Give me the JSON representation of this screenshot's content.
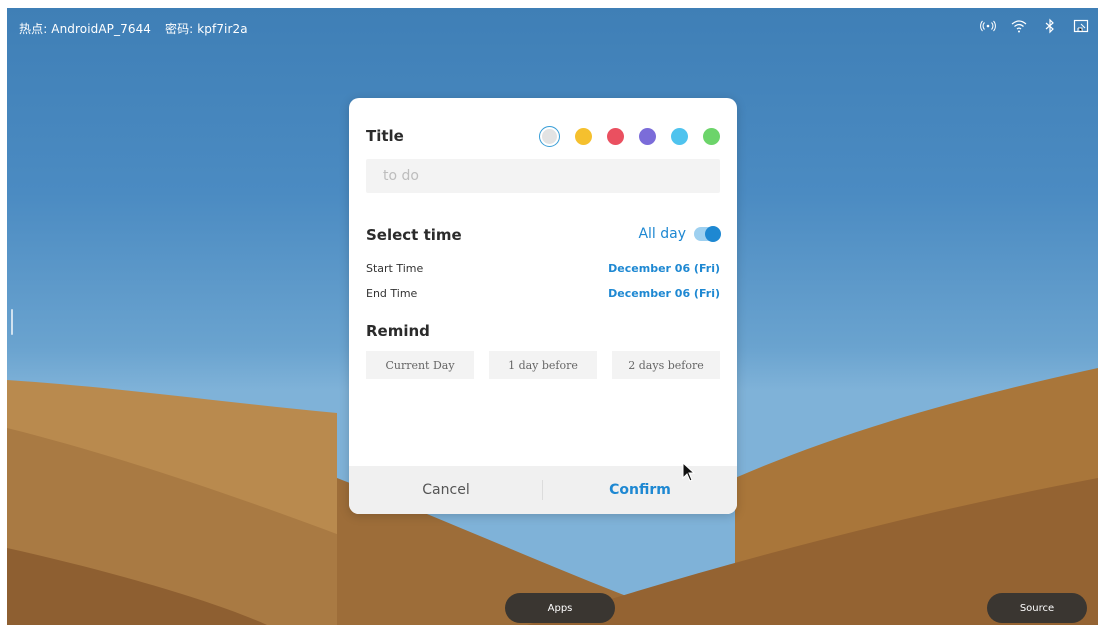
{
  "status_bar": {
    "hotspot_label": "热点: AndroidAP_7644",
    "password_label": "密码: kpf7ir2a",
    "icons": [
      "hotspot-icon",
      "wifi-icon",
      "bluetooth-icon",
      "screen-cast-icon"
    ]
  },
  "dialog": {
    "title_label": "Title",
    "title_placeholder": "to do",
    "colors": [
      "#e3e3e3",
      "#f5c02e",
      "#ea5060",
      "#7b6cd9",
      "#4fc3ee",
      "#6cd46a"
    ],
    "selected_color_index": 0,
    "select_time_label": "Select time",
    "all_day_label": "All day",
    "all_day_enabled": true,
    "start_time_label": "Start Time",
    "start_time_value": "December 06 (Fri)",
    "end_time_label": "End Time",
    "end_time_value": "December 06 (Fri)",
    "remind_label": "Remind",
    "remind_options": [
      "Current Day",
      "1 day before",
      "2 days before"
    ],
    "cancel_label": "Cancel",
    "confirm_label": "Confirm"
  },
  "dock": {
    "apps_label": "Apps",
    "source_label": "Source"
  }
}
